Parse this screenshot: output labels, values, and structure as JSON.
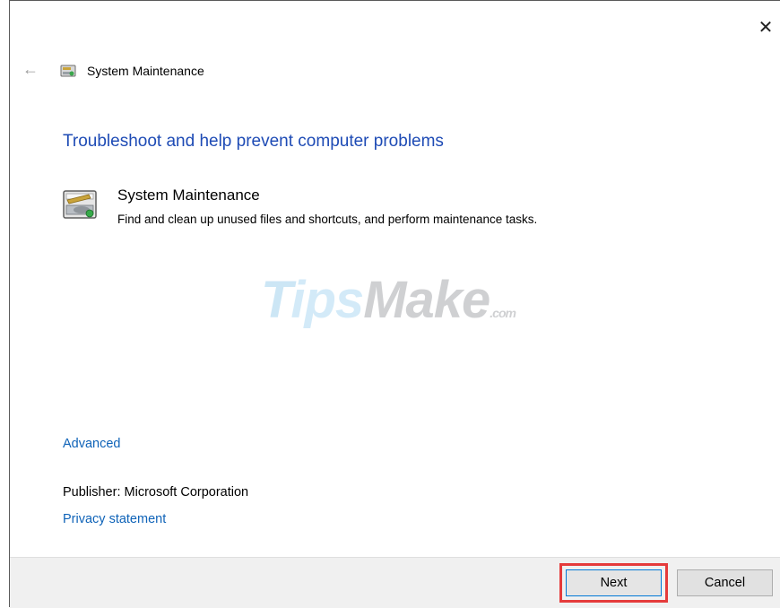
{
  "window": {
    "close_glyph": "✕",
    "back_glyph": "←",
    "title": "System Maintenance"
  },
  "main": {
    "heading": "Troubleshoot and help prevent computer problems",
    "item": {
      "title": "System Maintenance",
      "description": "Find and clean up unused files and shortcuts, and perform maintenance tasks.",
      "icon": "system-maintenance-icon"
    },
    "watermark": {
      "t": "T",
      "ips": "ips",
      "make": "Make",
      "com": ".com"
    },
    "advanced_link": "Advanced",
    "publisher_label": "Publisher:",
    "publisher_value": "Microsoft Corporation",
    "privacy_link": "Privacy statement"
  },
  "footer": {
    "next_label": "Next",
    "cancel_label": "Cancel"
  },
  "colors": {
    "heading_blue": "#1e4bb5",
    "link_blue": "#0f63b8",
    "highlight_red": "#e53b3b",
    "footer_bg": "#f0f0f0"
  }
}
